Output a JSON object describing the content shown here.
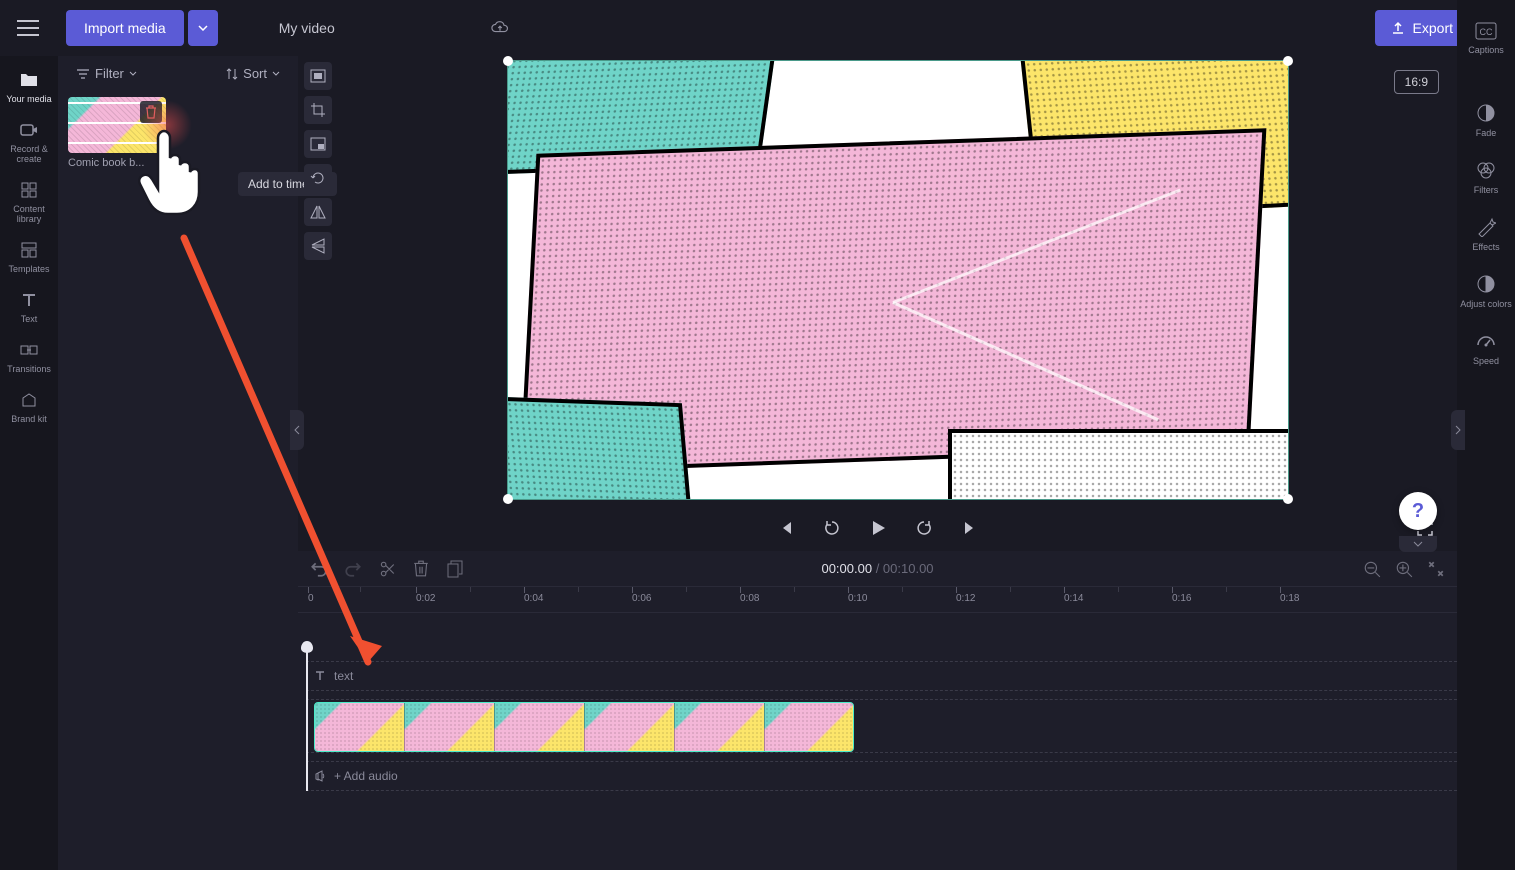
{
  "top": {
    "import_label": "Import media",
    "project_name": "My video",
    "export_label": "Export"
  },
  "left_sidebar": {
    "items": [
      {
        "label": "Your media",
        "icon": "folder"
      },
      {
        "label": "Record & create",
        "icon": "record"
      },
      {
        "label": "Content library",
        "icon": "library"
      },
      {
        "label": "Templates",
        "icon": "templates"
      },
      {
        "label": "Text",
        "icon": "text"
      },
      {
        "label": "Transitions",
        "icon": "transitions"
      },
      {
        "label": "Brand kit",
        "icon": "brand"
      }
    ]
  },
  "media_panel": {
    "filter_label": "Filter",
    "sort_label": "Sort",
    "items": [
      {
        "name": "Comic book b..."
      }
    ],
    "tooltip": "Add to timeline"
  },
  "stage": {
    "aspect": "16:9"
  },
  "right_sidebar": {
    "items": [
      {
        "label": "Captions",
        "icon": "captions"
      },
      {
        "label": "Fade",
        "icon": "fade"
      },
      {
        "label": "Filters",
        "icon": "filters"
      },
      {
        "label": "Effects",
        "icon": "effects"
      },
      {
        "label": "Adjust colors",
        "icon": "adjust"
      },
      {
        "label": "Speed",
        "icon": "speed"
      }
    ]
  },
  "timeline": {
    "current_time": "00:00.00",
    "total_time": "00:10.00",
    "ruler": [
      "0",
      "0:02",
      "0:04",
      "0:06",
      "0:08",
      "0:10",
      "0:12",
      "0:14",
      "0:16",
      "0:18"
    ],
    "text_track_hint": "text",
    "audio_track_hint": "+ Add audio"
  },
  "help_symbol": "?"
}
